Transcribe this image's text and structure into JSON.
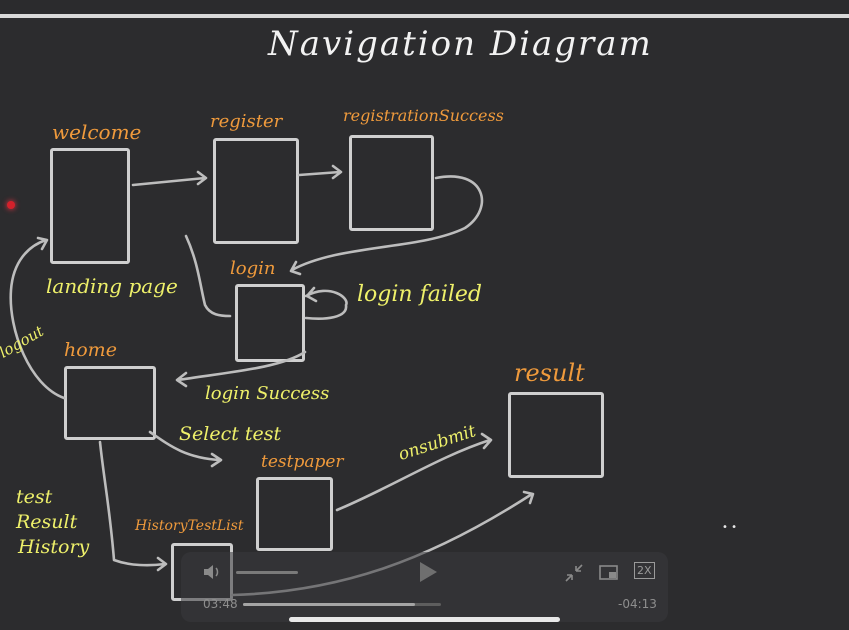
{
  "title": "Navigation Diagram",
  "screens": {
    "welcome": "welcome",
    "register": "register",
    "registration_success": "registrationSuccess",
    "login": "login",
    "home": "home",
    "test_paper": "testpaper",
    "result": "result",
    "history_test_list": "HistoryTestList"
  },
  "transitions": {
    "landing_page": "landing page",
    "login_failed": "login failed",
    "logout": "logout",
    "login_success": "login Success",
    "select_test": "Select test",
    "on_submit": "onsubmit",
    "test_result_history": [
      "test",
      "Result",
      "History"
    ]
  },
  "player": {
    "elapsed": "03:48",
    "remaining": "-04:13",
    "speed": "2X",
    "progress": 0.87
  }
}
